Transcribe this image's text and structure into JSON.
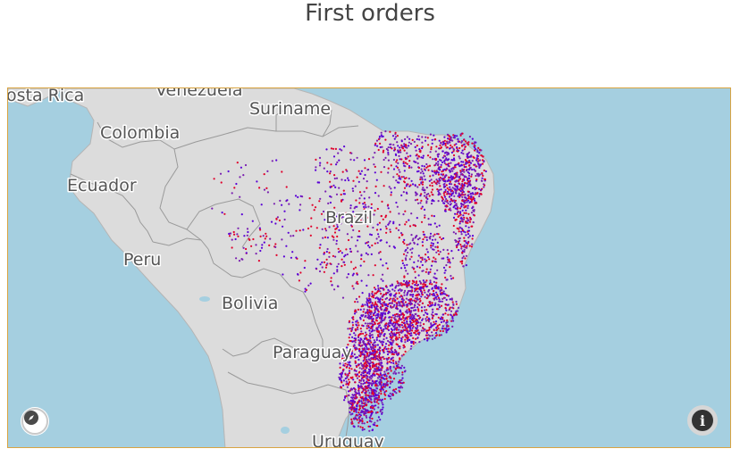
{
  "title": "First orders",
  "map": {
    "labels": {
      "costa_rica": "osta Rica",
      "venezuela": "Venezuela",
      "suriname": "Suriname",
      "colombia": "Colombia",
      "ecuador": "Ecuador",
      "brazil": "Brazil",
      "peru": "Peru",
      "bolivia": "Bolivia",
      "paraguay": "Paraguay",
      "uruguay": "Uruguay"
    },
    "colors": {
      "ocean": "#a5cfe0",
      "land": "#dcdcdc",
      "border": "#9e9e9e",
      "frame": "#d9a441",
      "points": [
        "#5a00d6",
        "#e0002b",
        "#7a1fb0"
      ]
    },
    "layer": {
      "type": "scatter",
      "description": "order locations",
      "marker_colors": [
        "purple",
        "red",
        "blue"
      ]
    },
    "controls": {
      "compass_icon": "compass-icon",
      "info_icon": "info-icon",
      "info_glyph": "i"
    }
  }
}
